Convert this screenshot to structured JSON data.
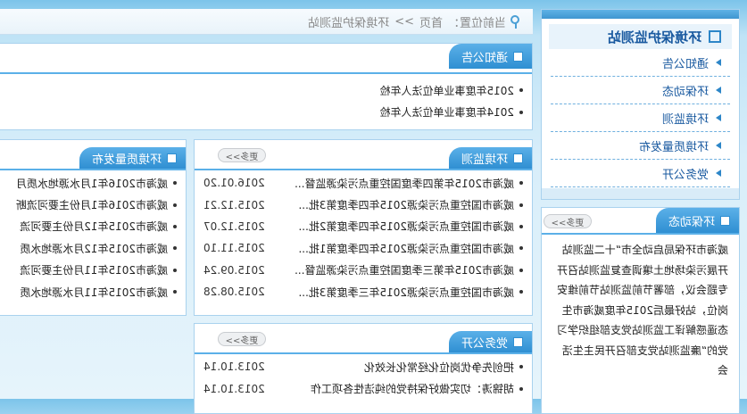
{
  "breadcrumb": {
    "label": "当前位置：",
    "home": "首页",
    "sep": ">>",
    "current": "环境保护监测站"
  },
  "sidebar": {
    "title": "环境保护监测站",
    "items": [
      {
        "label": "通知公告"
      },
      {
        "label": "环保动态"
      },
      {
        "label": "环境监测"
      },
      {
        "label": "环境质量发布"
      },
      {
        "label": "党务公开"
      }
    ]
  },
  "notice": {
    "tab": "通知公告",
    "items": [
      {
        "title": "2015年度事业单位法人年检"
      },
      {
        "title": "2014年度事业单位法人年检"
      }
    ]
  },
  "monitoring": {
    "tab": "环境监测",
    "more": "更多>>",
    "items": [
      {
        "title": "威海市2015年第四季度国控重点污染源监督...",
        "date": "2016.01.20"
      },
      {
        "title": "威海市国控重点污染源2015年四季度第3批...",
        "date": "2015.12.21"
      },
      {
        "title": "威海市国控重点污染源2015年四季度第2批...",
        "date": "2015.12.07"
      },
      {
        "title": "威海市国控重点污染源2015年四季度第1批...",
        "date": "2015.11.10"
      },
      {
        "title": "威海市2015年第三季度国控重点污染源监督...",
        "date": "2015.09.24"
      },
      {
        "title": "威海市国控重点污染源2015年三季度第3批...",
        "date": "2015.08.28"
      }
    ]
  },
  "quality": {
    "tab": "环境质量发布",
    "items": [
      {
        "title": "威海市2016年1月水源地水质月"
      },
      {
        "title": "威海市2016年1月份主要河流断"
      },
      {
        "title": "威海市2015年12月份主要河流"
      },
      {
        "title": "威海市2015年12月水源地水质"
      },
      {
        "title": "威海市2015年11月份主要河流"
      },
      {
        "title": "威海市2015年11月水源地水质"
      }
    ]
  },
  "party": {
    "tab": "党务公开",
    "more": "更多>>",
    "items": [
      {
        "title": "把创先争优岗位化经常化长效化",
        "date": "2013.10.14"
      },
      {
        "title": "胡锦涛：切实做好保持党的纯洁性各项工作",
        "date": "2013.10.14"
      }
    ]
  },
  "news": {
    "tab": "环保动态",
    "more": "更多>>",
    "text": "威海市环保局启动全市“十二监测站开展污染场地土壤调查复监测站召开专题会议，部署节前监测站节前维安岗位，站好最后2015年度威海市生态遥感解译工监测站党支部组织学习党的“廉监测站党支部召开民主生活会"
  }
}
